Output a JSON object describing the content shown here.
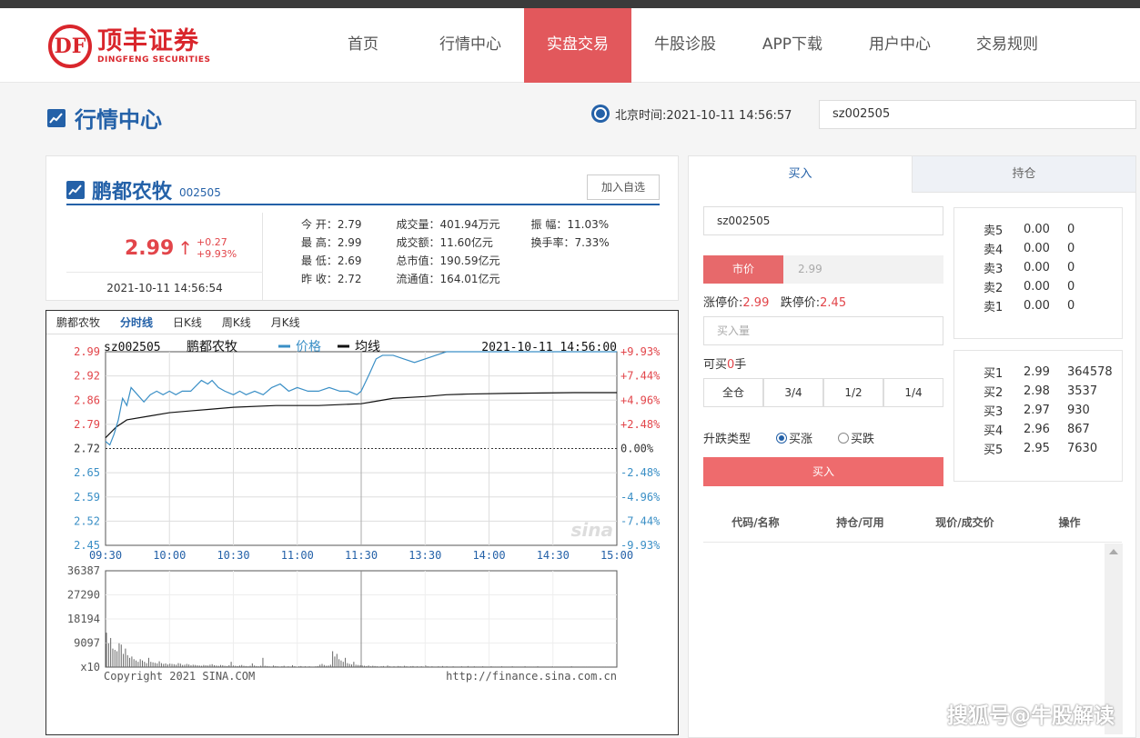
{
  "brand": {
    "cn": "顶丰证券",
    "en": "DINGFENG SECURITIES",
    "mark": "DF"
  },
  "nav": [
    {
      "label": "首页",
      "active": false
    },
    {
      "label": "行情中心",
      "active": false
    },
    {
      "label": "实盘交易",
      "active": true
    },
    {
      "label": "牛股诊股",
      "active": false
    },
    {
      "label": "APP下载",
      "active": false
    },
    {
      "label": "用户中心",
      "active": false
    },
    {
      "label": "交易规则",
      "active": false
    }
  ],
  "page": {
    "title": "行情中心",
    "clock": "北京时间:2021-10-11 14:56:57",
    "search_value": "sz002505"
  },
  "stock": {
    "name": "鹏都农牧",
    "code": "002505",
    "add_watch": "加入自选",
    "price": "2.99",
    "change": "+0.27",
    "change_pct": "+9.93%",
    "time": "2021-10-11 14:56:54",
    "stats": [
      [
        "今 开：2.79",
        "成交量：401.94万元",
        "振 幅：11.03%"
      ],
      [
        "最 高：2.99",
        "成交额：11.60亿元",
        "换手率：7.33%"
      ],
      [
        "最 低：2.69",
        "总市值：190.59亿元",
        ""
      ],
      [
        "昨 收：2.72",
        "流通值：164.01亿元",
        ""
      ]
    ]
  },
  "chart_tabs": [
    {
      "label": "鹏都农牧",
      "active": false
    },
    {
      "label": "分时线",
      "active": true
    },
    {
      "label": "日K线",
      "active": false
    },
    {
      "label": "周K线",
      "active": false
    },
    {
      "label": "月K线",
      "active": false
    }
  ],
  "chart_data": {
    "type": "line",
    "header_code": "sz002505",
    "header_name": "鹏都农牧",
    "legend": [
      {
        "name": "价格",
        "color": "#3a8fc6"
      },
      {
        "name": "均线",
        "color": "#111111"
      }
    ],
    "header_time": "2021-10-11 14:56:00",
    "y_price_ticks": [
      "2.99",
      "2.92",
      "2.86",
      "2.79",
      "2.72",
      "2.65",
      "2.59",
      "2.52",
      "2.45"
    ],
    "y_pct_ticks": [
      "+9.93%",
      "+7.44%",
      "+4.96%",
      "+2.48%",
      "0.00%",
      "-2.48%",
      "-4.96%",
      "-7.44%",
      "-9.93%"
    ],
    "ylim": [
      2.45,
      2.99
    ],
    "prev_close": 2.72,
    "x_ticks": [
      "09:30",
      "10:00",
      "10:30",
      "11:00",
      "11:30",
      "13:30",
      "14:00",
      "14:30",
      "15:00"
    ],
    "price_series": [
      [
        0,
        2.74
      ],
      [
        2,
        2.73
      ],
      [
        4,
        2.76
      ],
      [
        6,
        2.8
      ],
      [
        8,
        2.86
      ],
      [
        10,
        2.84
      ],
      [
        12,
        2.89
      ],
      [
        15,
        2.87
      ],
      [
        18,
        2.85
      ],
      [
        21,
        2.87
      ],
      [
        24,
        2.88
      ],
      [
        27,
        2.87
      ],
      [
        30,
        2.88
      ],
      [
        33,
        2.87
      ],
      [
        36,
        2.88
      ],
      [
        40,
        2.88
      ],
      [
        45,
        2.91
      ],
      [
        48,
        2.9
      ],
      [
        50,
        2.91
      ],
      [
        53,
        2.89
      ],
      [
        56,
        2.88
      ],
      [
        60,
        2.87
      ],
      [
        63,
        2.88
      ],
      [
        66,
        2.87
      ],
      [
        70,
        2.88
      ],
      [
        74,
        2.87
      ],
      [
        78,
        2.89
      ],
      [
        82,
        2.9
      ],
      [
        86,
        2.88
      ],
      [
        90,
        2.89
      ],
      [
        95,
        2.88
      ],
      [
        100,
        2.88
      ],
      [
        105,
        2.89
      ],
      [
        110,
        2.88
      ],
      [
        114,
        2.88
      ],
      [
        118,
        2.87
      ],
      [
        120,
        2.88
      ],
      [
        124,
        2.93
      ],
      [
        127,
        2.97
      ],
      [
        130,
        2.98
      ],
      [
        135,
        2.98
      ],
      [
        140,
        2.97
      ],
      [
        145,
        2.96
      ],
      [
        150,
        2.97
      ],
      [
        155,
        2.98
      ],
      [
        160,
        2.99
      ],
      [
        170,
        2.99
      ],
      [
        180,
        2.99
      ],
      [
        200,
        2.99
      ],
      [
        220,
        2.99
      ],
      [
        240,
        2.99
      ]
    ],
    "avg_series": [
      [
        0,
        2.75
      ],
      [
        5,
        2.78
      ],
      [
        10,
        2.8
      ],
      [
        20,
        2.81
      ],
      [
        30,
        2.82
      ],
      [
        40,
        2.825
      ],
      [
        50,
        2.83
      ],
      [
        60,
        2.835
      ],
      [
        80,
        2.84
      ],
      [
        100,
        2.84
      ],
      [
        120,
        2.845
      ],
      [
        125,
        2.85
      ],
      [
        135,
        2.86
      ],
      [
        150,
        2.865
      ],
      [
        160,
        2.87
      ],
      [
        170,
        2.872
      ],
      [
        190,
        2.874
      ],
      [
        220,
        2.876
      ],
      [
        240,
        2.876
      ]
    ],
    "volume_ticks": [
      "36387",
      "27290",
      "18194",
      "9097",
      "x10"
    ],
    "volume_max": 36387,
    "volume_series": [
      13000,
      9000,
      11000,
      7000,
      6500,
      6000,
      9000,
      8500,
      5000,
      7000,
      4500,
      3500,
      4000,
      3000,
      2500,
      2000,
      3000,
      2500,
      2000,
      1500,
      3500,
      2000,
      1800,
      1600,
      1400,
      2200,
      1500,
      1200,
      1400,
      1000,
      1300,
      1200,
      1100,
      900,
      1500,
      1300,
      800,
      900,
      1200,
      1000,
      700,
      900,
      800,
      700,
      600,
      500,
      800,
      700,
      600,
      900,
      1100,
      700,
      600,
      500,
      800,
      700,
      500,
      400,
      700,
      2000,
      600,
      500,
      400,
      600,
      800,
      500,
      400,
      300,
      500,
      1400,
      600,
      400,
      300,
      500,
      3500,
      500,
      400,
      300,
      200,
      600,
      400,
      300,
      200,
      300,
      500,
      200,
      300,
      200,
      700,
      300,
      200,
      300,
      400,
      200,
      300,
      200,
      300,
      200,
      200,
      300,
      400,
      900,
      1200,
      800,
      500,
      600,
      900,
      6000,
      4000,
      5000,
      3000,
      2500,
      2000,
      3500,
      1500,
      1200,
      1000,
      2000,
      900,
      800,
      700,
      600,
      500,
      400,
      600,
      300,
      500,
      400,
      300,
      200,
      300,
      400,
      200,
      600,
      300,
      200,
      300,
      200,
      400,
      300,
      200,
      500,
      300,
      200,
      300,
      400,
      200,
      300,
      200,
      300,
      200,
      600,
      300,
      200,
      300,
      200,
      200,
      300,
      200,
      400,
      200,
      300,
      200,
      200,
      300,
      200,
      200,
      200,
      300,
      200,
      200,
      400,
      200,
      200,
      300,
      200,
      200,
      200,
      300,
      200,
      200,
      200,
      300,
      200,
      200,
      200,
      200,
      300,
      200,
      200,
      200,
      200,
      300,
      200,
      200,
      200,
      200,
      200,
      300,
      200,
      200,
      200,
      200,
      200,
      300,
      200,
      200,
      200,
      200,
      200,
      200,
      300,
      200,
      200,
      200,
      200,
      200,
      200,
      200,
      200,
      300,
      200,
      200,
      200,
      200,
      200,
      200,
      200,
      200,
      200,
      200,
      200,
      200,
      200,
      200,
      200,
      200,
      200,
      200,
      200,
      200
    ],
    "copyright": "Copyright 2021 SINA.COM",
    "url": "http://finance.sina.com.cn",
    "logo": "sina"
  },
  "trade": {
    "tab_buy": "买入",
    "tab_hold": "持仓",
    "code_value": "sz002505",
    "market_btn": "市价",
    "price_placeholder": "2.99",
    "limit_up_label": "涨停价:",
    "limit_up": "2.99",
    "limit_down_label": "跌停价:",
    "limit_down": "2.45",
    "qty_placeholder": "买入量",
    "can_buy_label": "可买",
    "can_buy_value": "0",
    "can_buy_unit": "手",
    "ratios": [
      "全仓",
      "3/4",
      "1/2",
      "1/4"
    ],
    "type_label": "升跌类型",
    "type_up": "买涨",
    "type_down": "买跌",
    "buy_btn": "买入",
    "sell_book": [
      [
        "卖5",
        "0.00",
        "0"
      ],
      [
        "卖4",
        "0.00",
        "0"
      ],
      [
        "卖3",
        "0.00",
        "0"
      ],
      [
        "卖2",
        "0.00",
        "0"
      ],
      [
        "卖1",
        "0.00",
        "0"
      ]
    ],
    "buy_book": [
      [
        "买1",
        "2.99",
        "364578"
      ],
      [
        "买2",
        "2.98",
        "3537"
      ],
      [
        "买3",
        "2.97",
        "930"
      ],
      [
        "买4",
        "2.96",
        "867"
      ],
      [
        "买5",
        "2.95",
        "7630"
      ]
    ],
    "pos_headers": [
      "代码/名称",
      "持仓/可用",
      "现价/成交价",
      "操作"
    ]
  },
  "watermark": "搜狐号@牛股解读"
}
